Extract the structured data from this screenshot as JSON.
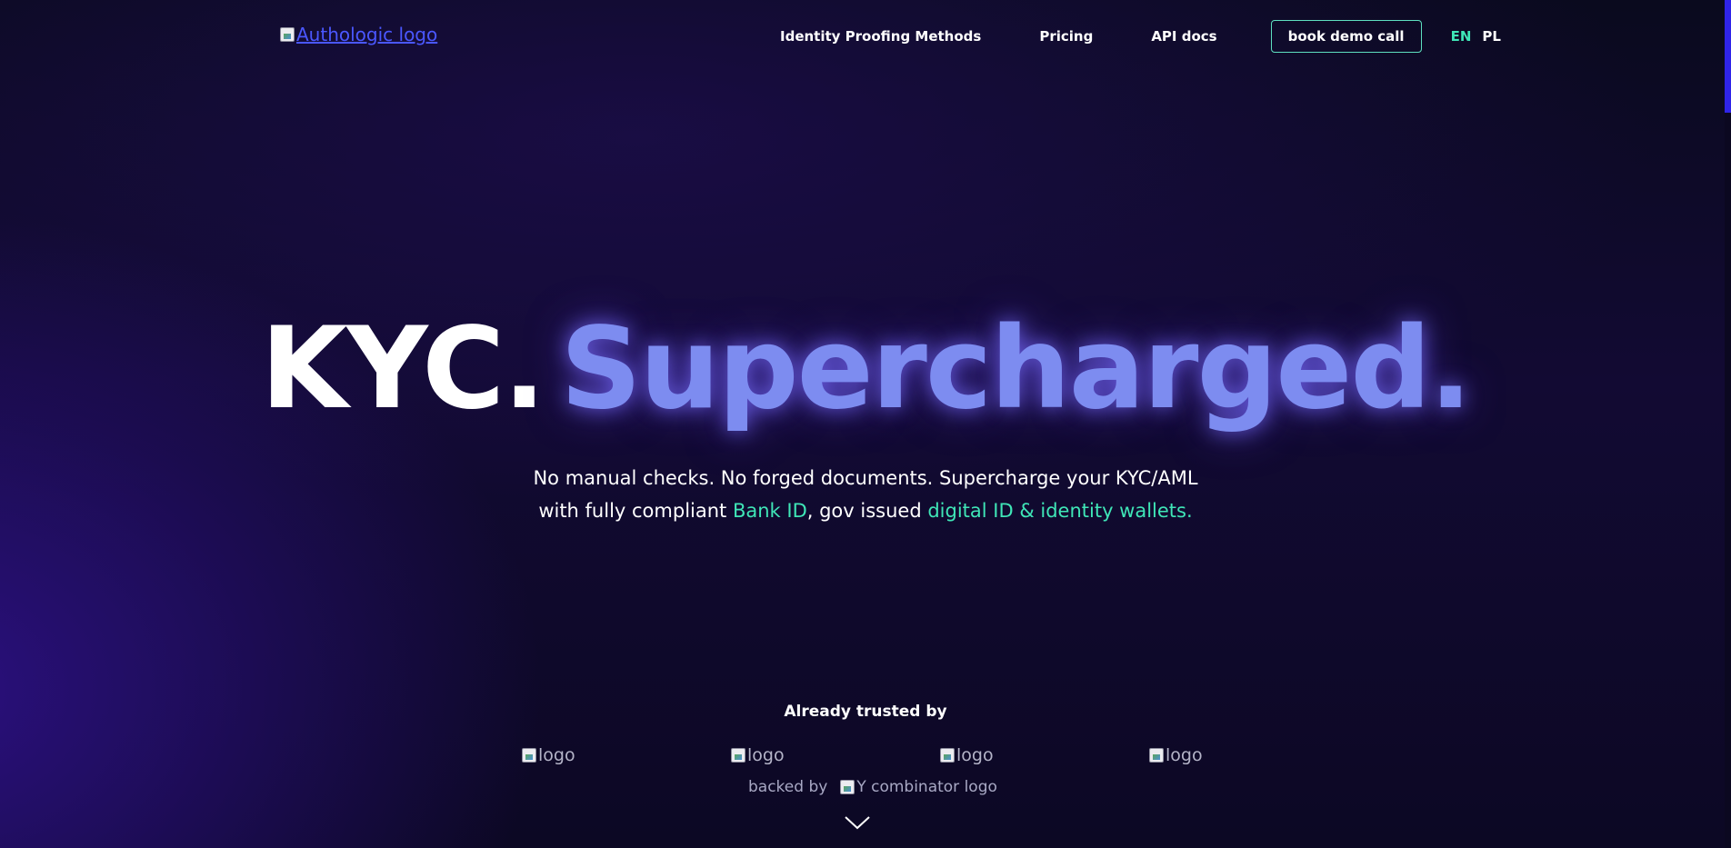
{
  "header": {
    "logo_alt": "Authologic logo",
    "nav": {
      "methods": "Identity Proofing Methods",
      "pricing": "Pricing",
      "api_docs": "API docs",
      "demo": "book demo call"
    },
    "lang": {
      "en": "EN",
      "pl": "PL"
    }
  },
  "hero": {
    "title_a": "KYC.",
    "title_b": "Supercharged.",
    "subtitle_line1": "No manual checks. No forged documents. Supercharge your KYC/AML",
    "subtitle_line2_a": "with fully compliant ",
    "subtitle_link1": "Bank ID",
    "subtitle_line2_b": ", gov issued ",
    "subtitle_link2": "digital ID & identity wallets."
  },
  "trusted": {
    "heading": "Already trusted by",
    "logos": [
      "logo",
      "logo",
      "logo",
      "logo"
    ],
    "backed_by": "backed by",
    "backer_alt": "Y combinator logo"
  },
  "colors": {
    "accent_green": "#3fe6b7",
    "accent_purple": "#7d8cf0",
    "link_blue": "#4a57ff",
    "scrollbar": "#2f24e8"
  },
  "icons": {
    "scroll_down": "chevron-down-icon"
  }
}
